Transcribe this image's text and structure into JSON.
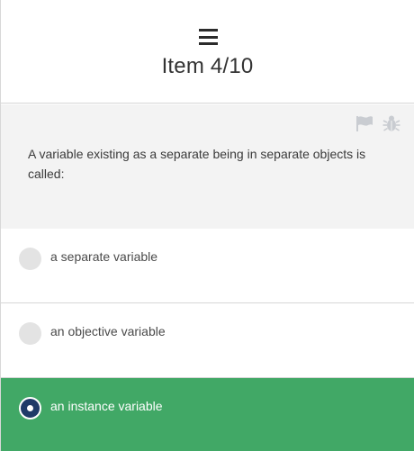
{
  "header": {
    "menu_icon": "hamburger-menu-icon",
    "title": "Item 4/10"
  },
  "toolbar": {
    "flag_icon": "flag-icon",
    "bug_icon": "bug-icon"
  },
  "question": {
    "text": "A variable existing as a separate being in separate objects is called:"
  },
  "options": [
    {
      "label": "a separate variable",
      "selected": false
    },
    {
      "label": "an objective variable",
      "selected": false
    },
    {
      "label": "an instance variable",
      "selected": true
    }
  ],
  "colors": {
    "selected_background": "#41a866",
    "selected_radio": "#1f3a68",
    "question_background": "#f3f3f3",
    "unselected_radio": "#e3e3e3",
    "icon_gray": "#c9ccd1"
  }
}
